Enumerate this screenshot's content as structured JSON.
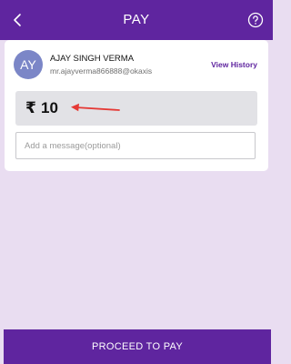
{
  "header": {
    "title": "PAY",
    "back_icon": "back-arrow-icon",
    "help_icon": "help-icon"
  },
  "payee": {
    "initials": "AY",
    "name": "AJAY SINGH VERMA",
    "upi_id": "mr.ajayverma866888@okaxis",
    "view_history_label": "View History"
  },
  "amount": {
    "currency_symbol": "₹",
    "value": "10",
    "annotation_icon": "red-arrow-icon"
  },
  "message": {
    "placeholder": "Add a message(optional)",
    "value": ""
  },
  "footer": {
    "proceed_label": "PROCEED TO PAY"
  },
  "colors": {
    "primary": "#5f259f",
    "background": "#e9ddf1",
    "avatar": "#7b86c7",
    "annotation": "#e53935"
  }
}
